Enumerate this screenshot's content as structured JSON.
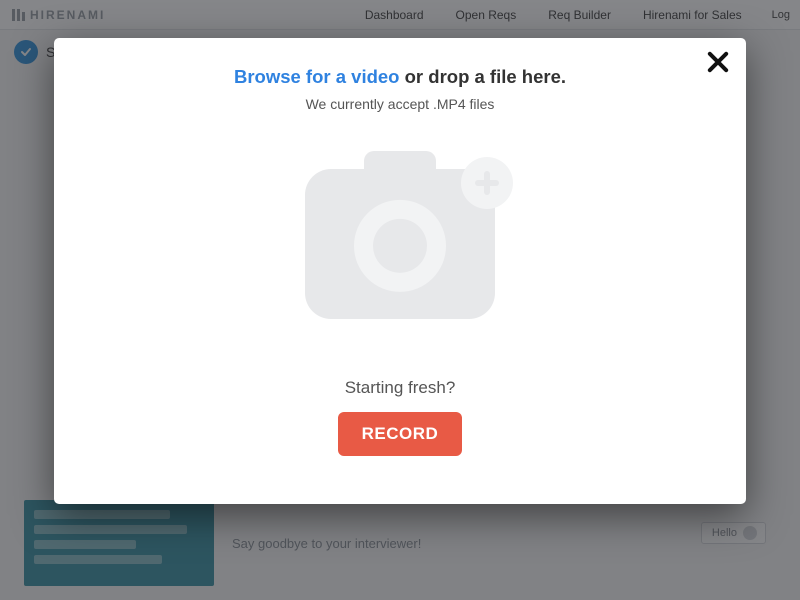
{
  "brand": "HIRENAMI",
  "nav": {
    "dashboard": "Dashboard",
    "open_reqs": "Open Reqs",
    "req_builder": "Req Builder",
    "sales": "Hirenami for Sales"
  },
  "login_label": "Log",
  "subhead_letter": "S",
  "teaser_text": "Say goodbye to your interviewer!",
  "hello_label": "Hello",
  "modal": {
    "browse_link": "Browse for a video",
    "or_drop": " or drop a file here.",
    "accept_note": "We currently accept .MP4 files",
    "fresh_prompt": "Starting fresh?",
    "record_label": "RECORD"
  }
}
